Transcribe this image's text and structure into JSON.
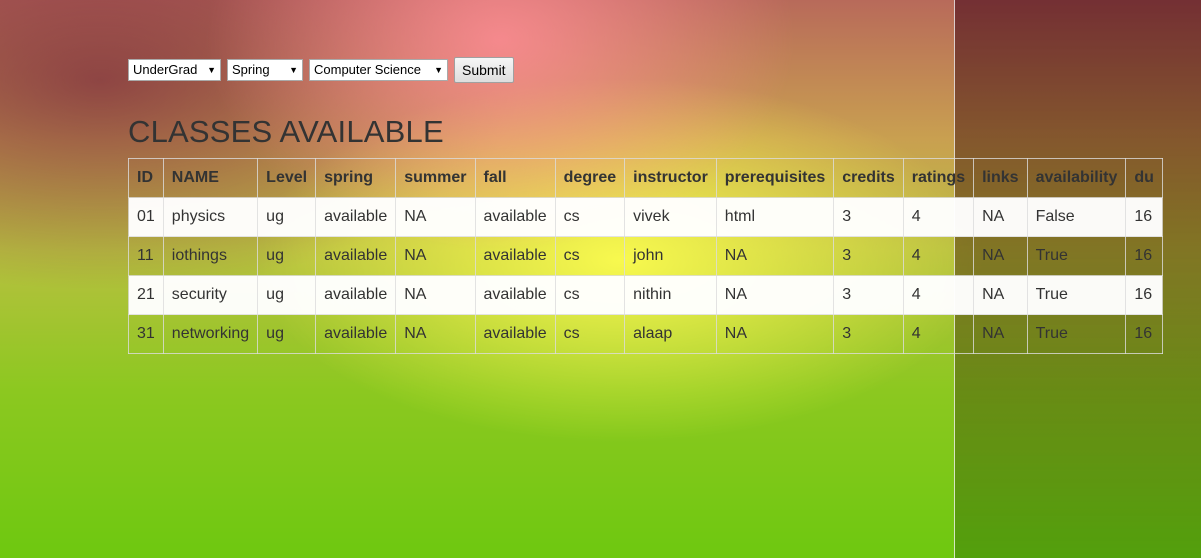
{
  "filters": {
    "level": "UnderGrad",
    "term": "Spring",
    "department": "Computer Science",
    "submit_label": "Submit"
  },
  "heading": "CLASSES AVAILABLE",
  "table": {
    "columns": [
      "ID",
      "NAME",
      "Level",
      "spring",
      "summer",
      "fall",
      "degree",
      "instructor",
      "prerequisites",
      "credits",
      "ratings",
      "links",
      "availability",
      "du"
    ],
    "rows": [
      [
        "01",
        "physics",
        "ug",
        "available",
        "NA",
        "available",
        "cs",
        "vivek",
        "html",
        "3",
        "4",
        "NA",
        "False",
        "16"
      ],
      [
        "11",
        "iothings",
        "ug",
        "available",
        "NA",
        "available",
        "cs",
        "john",
        "NA",
        "3",
        "4",
        "NA",
        "True",
        "16"
      ],
      [
        "21",
        "security",
        "ug",
        "available",
        "NA",
        "available",
        "cs",
        "nithin",
        "NA",
        "3",
        "4",
        "NA",
        "True",
        "16"
      ],
      [
        "31",
        "networking",
        "ug",
        "available",
        "NA",
        "available",
        "cs",
        "alaap",
        "NA",
        "3",
        "4",
        "NA",
        "True",
        "16"
      ]
    ]
  }
}
